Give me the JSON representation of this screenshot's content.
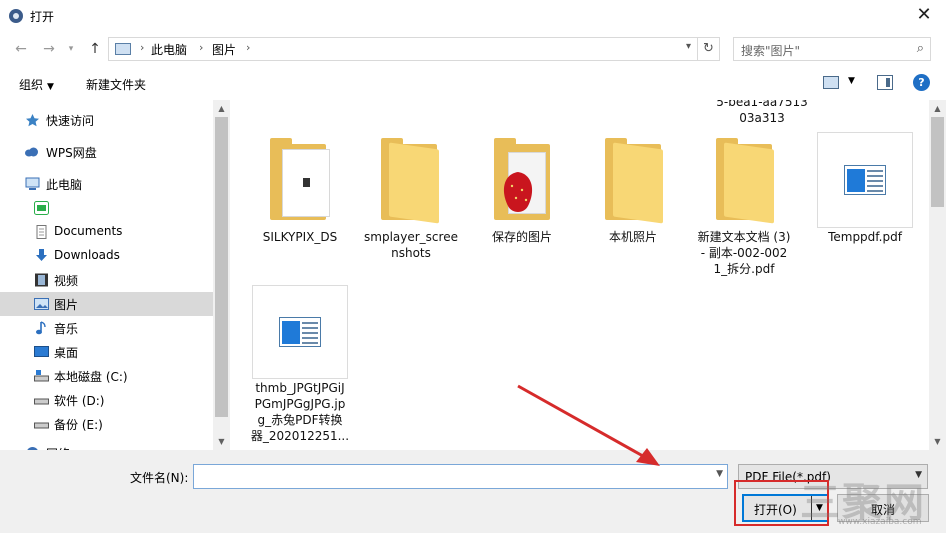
{
  "window": {
    "title": "打开",
    "close": "✕"
  },
  "address": {
    "segments": [
      "此电脑",
      "图片"
    ],
    "search_placeholder": "搜索\"图片\""
  },
  "toolbar": {
    "organize": "组织",
    "new_folder": "新建文件夹",
    "help": "?"
  },
  "nav": {
    "items": [
      {
        "label": "快速访问",
        "icon": "star-pin-icon"
      },
      {
        "label": "WPS网盘",
        "icon": "cloud-icon"
      },
      {
        "label": "此电脑",
        "icon": "computer-icon"
      },
      {
        "label": "",
        "icon": "wechat-file-icon"
      },
      {
        "label": "Documents",
        "icon": "document-icon"
      },
      {
        "label": "Downloads",
        "icon": "download-arrow-icon"
      },
      {
        "label": "视频",
        "icon": "video-icon"
      },
      {
        "label": "图片",
        "icon": "picture-icon",
        "selected": true
      },
      {
        "label": "音乐",
        "icon": "music-note-icon"
      },
      {
        "label": "桌面",
        "icon": "desktop-icon"
      },
      {
        "label": "本地磁盘 (C:)",
        "icon": "system-drive-icon"
      },
      {
        "label": "软件 (D:)",
        "icon": "drive-icon"
      },
      {
        "label": "备份 (E:)",
        "icon": "drive-icon"
      },
      {
        "label": "网络",
        "icon": "network-icon"
      }
    ]
  },
  "files": {
    "partial_label": [
      "5-bea1-aa7513",
      "03a313"
    ],
    "row1": [
      {
        "name": [
          "SILKYPIX_DS"
        ],
        "type": "folder-doc"
      },
      {
        "name": [
          "smplayer_scree",
          "nshots"
        ],
        "type": "folder"
      },
      {
        "name": [
          "保存的图片"
        ],
        "type": "folder-photo"
      },
      {
        "name": [
          "本机照片"
        ],
        "type": "folder"
      },
      {
        "name": [
          "新建文本文档 (3)",
          "- 副本-002-002",
          "1_拆分.pdf"
        ],
        "type": "folder"
      },
      {
        "name": [
          "Temppdf.pdf"
        ],
        "type": "pdf"
      }
    ],
    "row2": [
      {
        "name": [
          "thmb_JPGtJPGiJ",
          "PGmJPGgJPG.jp",
          "g_赤兔PDF转换",
          "器_202012251..."
        ],
        "type": "pdf"
      }
    ]
  },
  "bottom": {
    "filename_label": "文件名(N):",
    "filename_value": "",
    "filter": "PDF File(*.pdf)",
    "open": "打开(O)",
    "cancel": "取消"
  },
  "watermark": {
    "text": "三聚网",
    "url": "www.xiazaiba.com"
  },
  "colors": {
    "highlight": "#d62b2b",
    "accent": "#0078d7",
    "folder": "#f8d775"
  }
}
